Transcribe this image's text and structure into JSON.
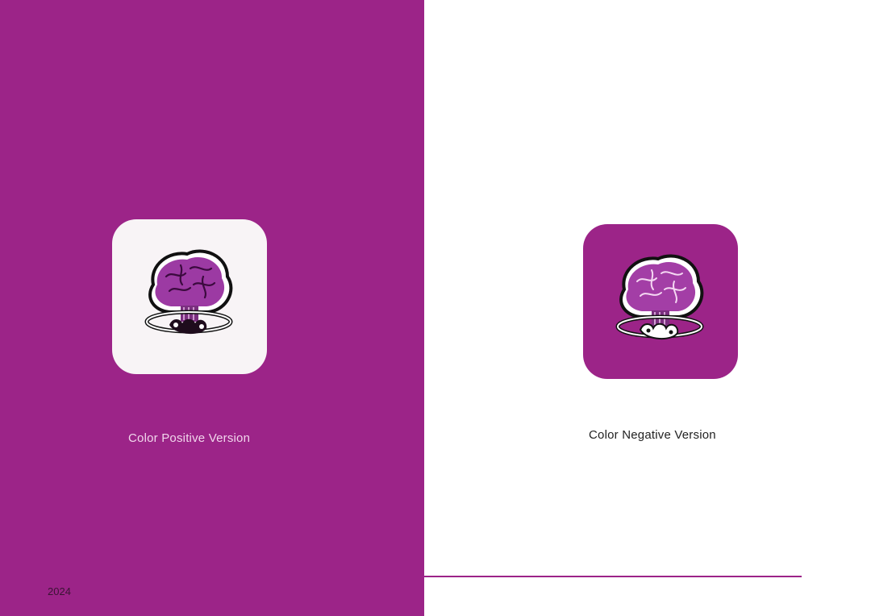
{
  "page": {
    "year": "2024",
    "colors": {
      "brand_purple": "#9c2488",
      "tile_light": "#f8f4f6",
      "white": "#ffffff"
    }
  },
  "left": {
    "caption": "Color Positive Version",
    "icon": "exploding-brain-icon"
  },
  "right": {
    "caption": "Color Negative Version",
    "icon": "exploding-brain-icon"
  }
}
